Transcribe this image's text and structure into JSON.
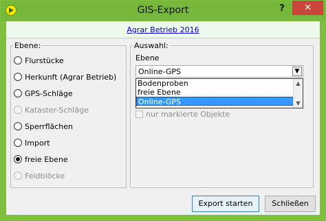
{
  "window": {
    "title": "GIS-Export",
    "help_label": "?",
    "close_label": "✕"
  },
  "banner": {
    "link_text": "Agrar Betrieb 2016"
  },
  "ebene_group": {
    "title": "Ebene:",
    "options": [
      {
        "label": "Flurstücke",
        "checked": false,
        "disabled": false
      },
      {
        "label": "Herkunft (Agrar Betrieb)",
        "checked": false,
        "disabled": false
      },
      {
        "label": "GPS-Schläge",
        "checked": false,
        "disabled": false
      },
      {
        "label": "Kataster-Schläge",
        "checked": false,
        "disabled": true
      },
      {
        "label": "Sperrflächen",
        "checked": false,
        "disabled": false
      },
      {
        "label": "Import",
        "checked": false,
        "disabled": false
      },
      {
        "label": "freie Ebene",
        "checked": true,
        "disabled": false
      },
      {
        "label": "Feldblöcke",
        "checked": false,
        "disabled": true
      }
    ]
  },
  "auswahl_group": {
    "title": "Auswahl:",
    "ebene_label": "Ebene",
    "combo_value": "Online-GPS",
    "list_items": [
      "Bodenproben",
      "freie Ebene",
      "Online-GPS"
    ],
    "selected_index": 2,
    "checkbox_label": "nur markierte Objekte"
  },
  "buttons": {
    "export_label": "Export starten",
    "close_label": "Schließen"
  },
  "colors": {
    "title_bar": "#76b83a",
    "close_button": "#c7483a",
    "banner_bg": "#ecf9ec",
    "link": "#0000c8",
    "selection": "#3399ff"
  }
}
